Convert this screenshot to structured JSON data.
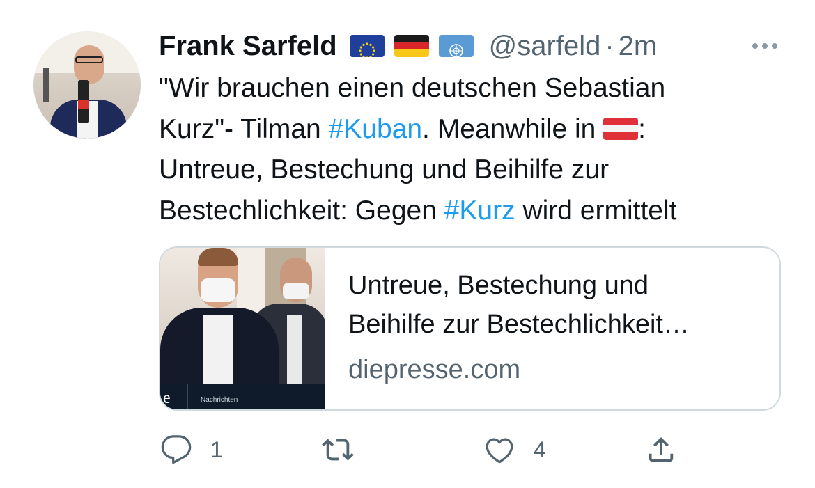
{
  "tweet": {
    "author_name": "Frank Sarfeld",
    "author_flags": [
      "eu-flag-icon",
      "germany-flag-icon",
      "un-flag-icon"
    ],
    "handle": "@sarfeld",
    "separator": "·",
    "time": "2m",
    "text_line1": "\"Wir brauchen einen deutschen Sebastian",
    "text_line2_a": "Kurz\"- Tilman ",
    "hashtag1": "#Kuban",
    "text_line2_b": ". Meanwhile in ",
    "text_line2_c": ":",
    "text_line3": "Untreue, Bestechung und Beihilfe zur",
    "text_line4_a": "Bestechlichkeit: Gegen ",
    "hashtag2": "#Kurz",
    "text_line4_b": " wird ermittelt"
  },
  "card": {
    "title_line1": "Untreue, Bestechung und",
    "title_line2": "Beihilfe zur Bestechlichkeit…",
    "domain": "diepresse.com",
    "image_caption": "Nachrichten",
    "image_logo": "e"
  },
  "actions": {
    "reply_count": "1",
    "retweet_count": "",
    "like_count": "4"
  },
  "colors": {
    "text": "#0f1419",
    "secondary": "#536471",
    "link": "#1d9bf0",
    "border": "#cfd9de"
  }
}
